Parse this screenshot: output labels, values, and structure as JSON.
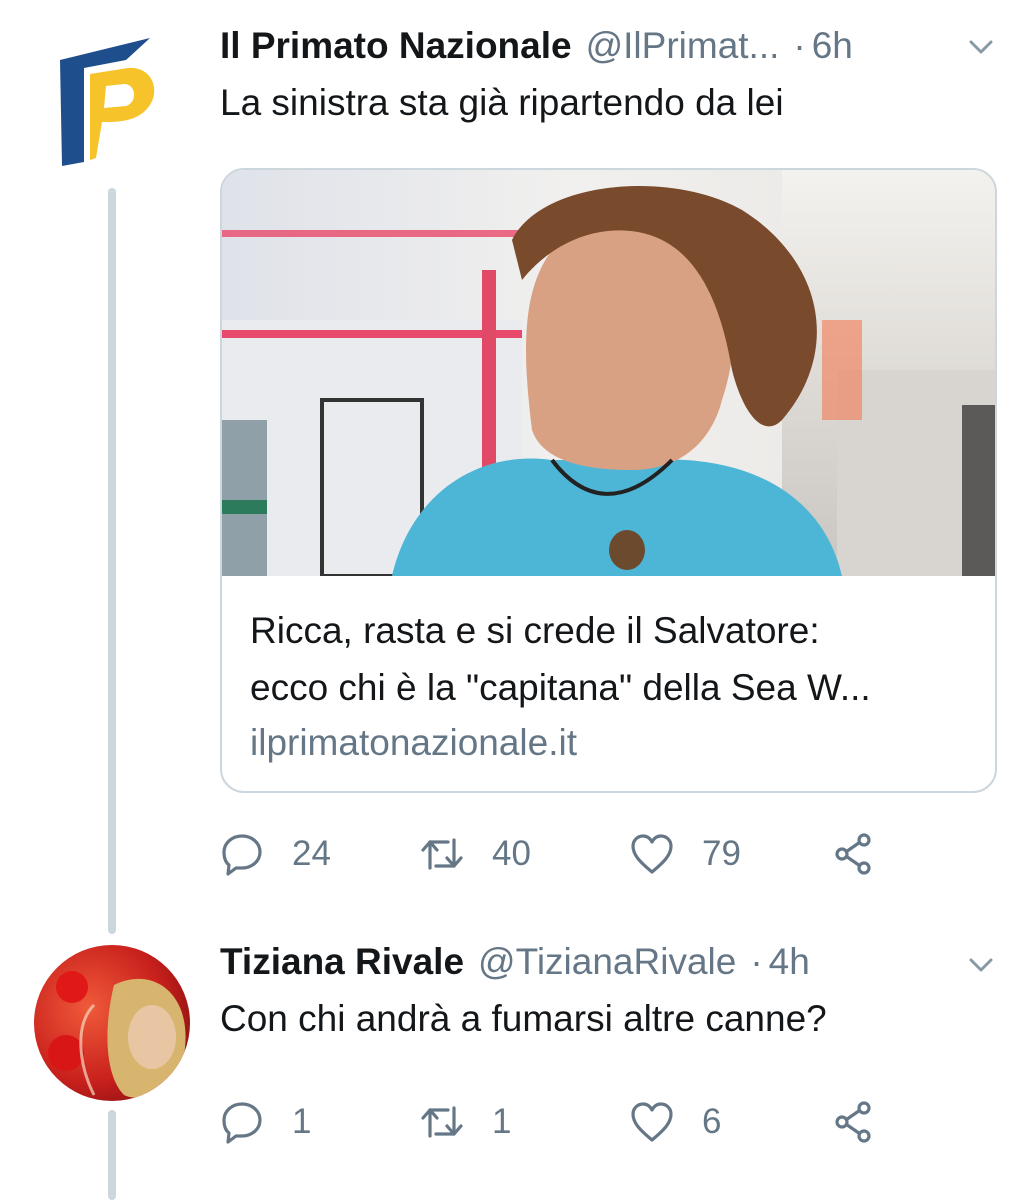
{
  "tweets": [
    {
      "name": "Il Primato Nazionale",
      "handle": "@IlPrimat...",
      "separator": "·",
      "time": "6h",
      "text": "La sinistra sta già ripartendo da lei",
      "avatar_icon": "primato-logo-icon",
      "card": {
        "title_line1": "Ricca, rasta e si crede il Salvatore:",
        "title_line2": "ecco chi è la \"capitana\" della Sea W...",
        "domain": "ilprimatonazionale.it"
      },
      "actions": {
        "replies": "24",
        "retweets": "40",
        "likes": "79"
      }
    },
    {
      "name": "Tiziana Rivale",
      "handle": "@TizianaRivale",
      "separator": "·",
      "time": "4h",
      "text": "Con chi andrà a fumarsi altre canne?",
      "avatar_icon": "user-avatar-photo",
      "actions": {
        "replies": "1",
        "retweets": "1",
        "likes": "6"
      }
    }
  ],
  "colors": {
    "text": "#14171a",
    "secondary": "#657786",
    "border": "#ccd6dd",
    "logo_blue": "#1f4e8c",
    "logo_yellow": "#f6c42a"
  }
}
